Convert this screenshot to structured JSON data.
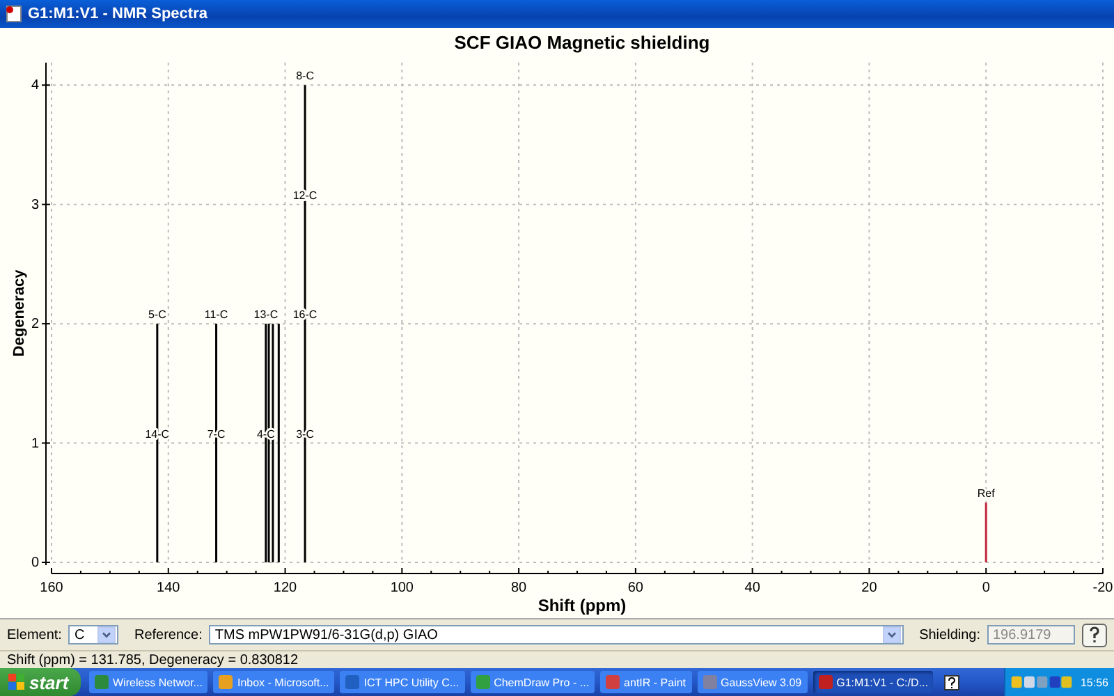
{
  "window": {
    "title": "G1:M1:V1 - NMR Spectra"
  },
  "spectrum": {
    "chart_data": {
      "type": "bar",
      "title": "SCF GIAO Magnetic shielding",
      "xlabel": "Shift (ppm)",
      "ylabel": "Degeneracy",
      "x": [
        141.9,
        131.8,
        123.3,
        122.8,
        122.1,
        121.1,
        116.6,
        0
      ],
      "series": [
        {
          "color": "#000000",
          "values": [
            2,
            2,
            2,
            2,
            2,
            2,
            4,
            null
          ]
        },
        {
          "color": "#c0283c",
          "values": [
            null,
            null,
            null,
            null,
            null,
            null,
            null,
            0.5
          ]
        }
      ],
      "grid": true,
      "xlim": [
        160,
        -20
      ],
      "ylim": [
        0,
        4.2
      ],
      "xticks": [
        160,
        140,
        120,
        100,
        80,
        60,
        40,
        20,
        0,
        -20
      ],
      "yticks": [
        0,
        1,
        2,
        3,
        4
      ],
      "annotations": [
        {
          "text": "5-C",
          "x": 141.9,
          "y": 2
        },
        {
          "text": "14-C",
          "x": 141.9,
          "y": 1
        },
        {
          "text": "11-C",
          "x": 131.8,
          "y": 2
        },
        {
          "text": "7-C",
          "x": 131.8,
          "y": 1
        },
        {
          "text": "13-C",
          "x": 123.3,
          "y": 2
        },
        {
          "text": "4-C",
          "x": 123.3,
          "y": 1
        },
        {
          "text": "8-C",
          "x": 116.6,
          "y": 4
        },
        {
          "text": "12-C",
          "x": 116.6,
          "y": 3
        },
        {
          "text": "16-C",
          "x": 116.6,
          "y": 2
        },
        {
          "text": "3-C",
          "x": 116.6,
          "y": 1
        },
        {
          "text": "Ref",
          "x": 0,
          "y": 0.5
        }
      ]
    }
  },
  "controls": {
    "element_label": "Element:",
    "element": "C",
    "reference_label": "Reference:",
    "reference": "TMS mPW1PW91/6-31G(d,p) GIAO",
    "shielding_label": "Shielding:",
    "shielding": "196.9179"
  },
  "status_bar": "Shift (ppm) = 131.785,  Degeneracy = 0.830812",
  "taskbar": {
    "start": "start",
    "items": [
      {
        "label": "Wireless Networ...",
        "selected": false,
        "color": "#2c8a3c"
      },
      {
        "label": "Inbox - Microsoft...",
        "selected": false,
        "color": "#e8a020"
      },
      {
        "label": "ICT HPC Utility C...",
        "selected": false,
        "color": "#2060c0"
      },
      {
        "label": "ChemDraw Pro - ...",
        "selected": false,
        "color": "#30a040"
      },
      {
        "label": "antIR - Paint",
        "selected": false,
        "color": "#d04040"
      },
      {
        "label": "GaussView 3.09",
        "selected": false,
        "color": "#8080a0"
      },
      {
        "label": "G1:M1:V1 - C:/D...",
        "selected": true,
        "color": "#c02020"
      }
    ],
    "clock": "15:56"
  }
}
